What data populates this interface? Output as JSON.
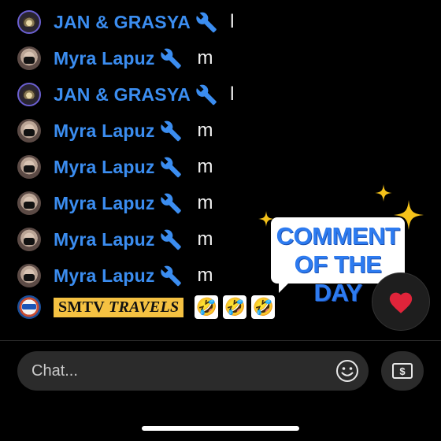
{
  "comments": [
    {
      "avatar": "jan",
      "name": "JAN & GRASYA",
      "message": "l"
    },
    {
      "avatar": "myra",
      "name": "Myra Lapuz",
      "message": "m"
    },
    {
      "avatar": "jan",
      "name": "JAN & GRASYA",
      "message": "l"
    },
    {
      "avatar": "myra",
      "name": "Myra Lapuz",
      "message": "m"
    },
    {
      "avatar": "myra",
      "name": "Myra Lapuz",
      "message": "m"
    },
    {
      "avatar": "myra",
      "name": "Myra Lapuz",
      "message": "m"
    },
    {
      "avatar": "myra",
      "name": "Myra Lapuz",
      "message": "m"
    },
    {
      "avatar": "myra",
      "name": "Myra Lapuz",
      "message": "m"
    }
  ],
  "featured_comment": {
    "name_part1": "SMTV",
    "name_part2": "TRAVELS",
    "emojis": [
      "🤣",
      "🤣",
      "🤣"
    ]
  },
  "comment_of_the_day": {
    "line1": "COMMENT",
    "line2": "OF THE DAY"
  },
  "heart": "❤️",
  "chat_input": {
    "placeholder": "Chat..."
  },
  "colors": {
    "name": "#3b8df0",
    "badge": "#f5c242",
    "cotd": "#2d7bf0",
    "heart": "#e0243a"
  },
  "icons": {
    "moderator": "wrench-icon",
    "emoji": "smiley-icon",
    "tip": "money-icon"
  }
}
